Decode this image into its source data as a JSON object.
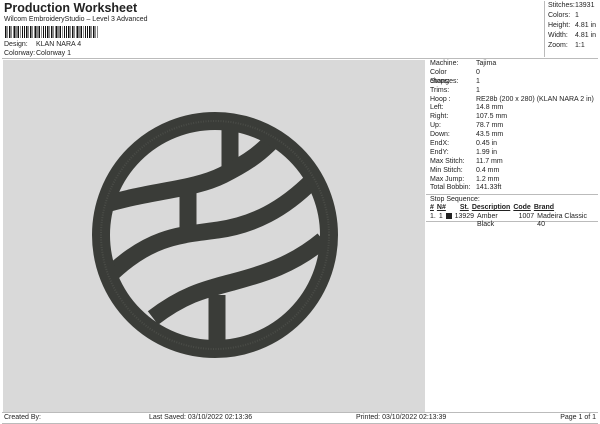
{
  "header": {
    "title": "Production Worksheet",
    "software": "Wilcom EmbroideryStudio – Level 3 Advanced",
    "design_label": "Design:",
    "design": "KLAN NARA 4",
    "colorway_label": "Colorway:",
    "colorway": "Colorway 1"
  },
  "summary": [
    {
      "label": "Stitches:",
      "value": "13931"
    },
    {
      "label": "Colors:",
      "value": "1"
    },
    {
      "label": "Height:",
      "value": "4.81 in"
    },
    {
      "label": "Width:",
      "value": "4.81 in"
    },
    {
      "label": "Zoom:",
      "value": "1:1"
    }
  ],
  "details": [
    {
      "label": "Machine:",
      "value": "Tajima"
    },
    {
      "label": "Color changes:",
      "value": "0"
    },
    {
      "label": "Stops:",
      "value": "1"
    },
    {
      "label": "Trims:",
      "value": "1"
    },
    {
      "label": "Hoop :",
      "value": "RE28b (200 x 280) (KLAN NARA 2 in)"
    },
    {
      "label": "Left:",
      "value": "14.8 mm"
    },
    {
      "label": "Right:",
      "value": "107.5 mm"
    },
    {
      "label": "Up:",
      "value": "78.7 mm"
    },
    {
      "label": "Down:",
      "value": "43.5 mm"
    },
    {
      "label": "EndX:",
      "value": "0.45 in"
    },
    {
      "label": "EndY:",
      "value": "1.99 in"
    },
    {
      "label": "Max Stitch:",
      "value": "11.7 mm"
    },
    {
      "label": "Min Stitch:",
      "value": "0.4 mm"
    },
    {
      "label": "Max Jump:",
      "value": "1.2 mm"
    },
    {
      "label": "Total Bobbin:",
      "value": "141.33ft"
    }
  ],
  "stop_sequence": {
    "title": "Stop Sequence:",
    "headers": [
      "#",
      "N#",
      "St.",
      "Description",
      "Code",
      "Brand"
    ],
    "rows": [
      {
        "num": "1.",
        "n": "1",
        "color": "#222222",
        "st": "13929",
        "description": "Amber Black",
        "code": "1007",
        "brand": "Madeira Classic 40"
      }
    ]
  },
  "design_colors": {
    "thread": "#3a3c38",
    "background": "#d9d9d9"
  },
  "footer": {
    "created_by": "Created By:",
    "last_saved": "Last Saved: 03/10/2022 02:13:36",
    "printed": "Printed: 03/10/2022 02:13:39",
    "page": "Page 1 of 1"
  }
}
